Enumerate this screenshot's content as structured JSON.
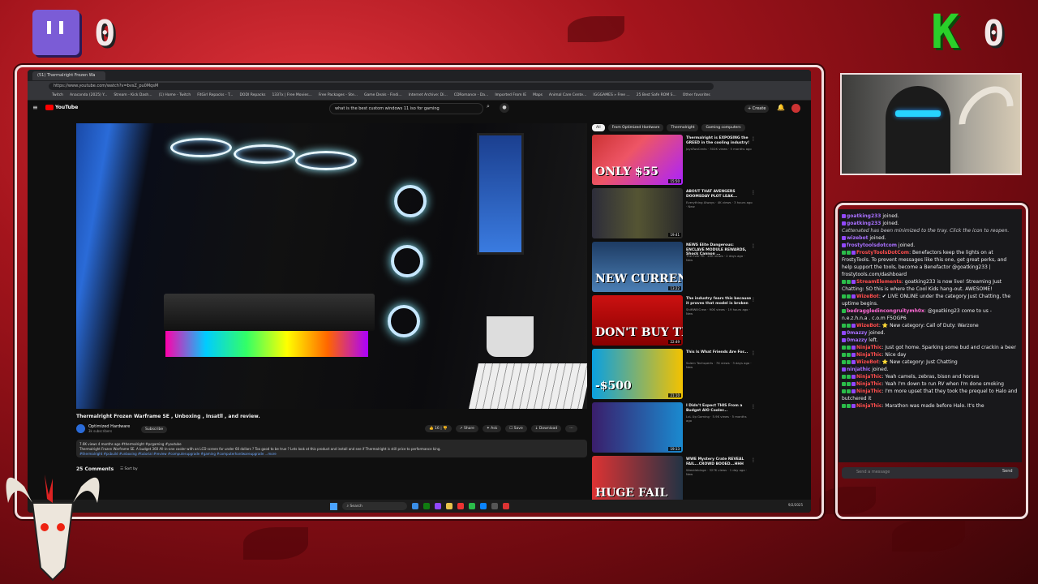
{
  "overlay": {
    "twitch_score": "0",
    "kick_score": "0",
    "colors": {
      "accent_red": "#c0141c",
      "twitch": "#7b5cd6",
      "kick": "#2ad02a"
    }
  },
  "browser": {
    "tab_title": "(51) Thermalright Frozen Wa",
    "url": "https://www.youtube.com/watch?v=bvsZ_pu0MqsM",
    "bookmarks": [
      "Twitch",
      "Anaconda (2025) Y...",
      "Stream - Kick Dash...",
      "(1) Home - Twitch",
      "FitGirl Repacks - T...",
      "DODI Repacks",
      "1337x | Free Movies...",
      "Free Packages - Ste...",
      "Game Deals - Findi...",
      "Internet Archive: Di...",
      "CDRomance - Da...",
      "Imported From IE",
      "Maps",
      "Animal Care Cente...",
      "IGGGAMES » Free ...",
      "25 Best Safe ROM S...",
      "Other favorites"
    ]
  },
  "youtube": {
    "logo_text": "YouTube",
    "search_query": "what is the best custom windows 11 iso for gaming",
    "create_label": "+ Create",
    "video_title": "Thermalright Frozen Warframe SE , Unboxing , Insatll , and review.",
    "channel_name": "Optimized Hardware",
    "channel_subs": "3k subscribers",
    "subscribe_label": "Subscribe",
    "likes": "16",
    "share_label": "Share",
    "ask_label": "Ask",
    "save_label": "Save",
    "download_label": "Download",
    "desc_line1": "7.6K views  4 months ago  #thermalright #pcgaming #youtube",
    "desc_line2": "Thermalright Frozen Warframe SE. A budget 360 All-in-one cooler with an LCD screen for under 60 dollars ? Too good to be true ? Lets look at this product and install and see if Thermalright is still price to performance king.",
    "desc_line3": "#thermalright #pcbuild #unboxing #tutorial #review #computerupgrade #gaming #computerhardwareupgrade ...more",
    "comments_label": "25 Comments",
    "sort_label": "Sort by",
    "chips": [
      "All",
      "From Optimized Hardware",
      "Thermalright",
      "Gaming computers"
    ],
    "recommended": [
      {
        "thumb_text": "ONLY $55",
        "duration": "15:50",
        "title": "Thermalright is EXPOSING the GREED in the cooling industry!",
        "meta": "JaysTwoCents · 302K views · 5 months ago"
      },
      {
        "thumb_text": "",
        "duration": "19:41",
        "title": "ABOUT THAT AVENGERS DOOMSDAY PLOT LEAK...",
        "meta": "Everything Always · 4K views · 3 hours ago · New"
      },
      {
        "thumb_text": "NEW CURRENCY EXPOSED",
        "duration": "13:22",
        "title": "NEWS Elite Dangerous: ENCLAVE MODULE REWARDS, Shock Cannon ...",
        "meta": "The Ever PK · 22K views · 2 days ago · New"
      },
      {
        "thumb_text": "DON'T BUY THIS",
        "duration": "22:49",
        "title": "The industry fears this because it proves that model is broken",
        "meta": "ShiftWillCrew · 90K views · 19 hours ago · New"
      },
      {
        "thumb_text": "-$500",
        "duration": "21:10",
        "title": "This Is What Friends Are For...",
        "meta": "Salem Techsperts · 7K views · 3 days ago · New"
      },
      {
        "thumb_text": "",
        "duration": "19:13",
        "title": "I Didn't Expect THIS From a Budget AIO Cooler...",
        "meta": "LvL Up Gaming · 5.9K views · 5 months ago"
      },
      {
        "thumb_text": "HUGE FAIL",
        "duration": "",
        "title": "WWE Mystery Crate REVEAL FAIL...CROWD BOOED...HHH",
        "meta": "Wrestlebinge · 327K views · 1 day ago · New"
      }
    ]
  },
  "taskbar": {
    "search_placeholder": "Search",
    "tray_text": "9/2/2025"
  },
  "chat": {
    "messages": [
      {
        "user": "goatking233",
        "text": " joined.",
        "color": "#a970ff",
        "badges": [
          "p"
        ]
      },
      {
        "user": "goatking233",
        "text": " joined.",
        "color": "#a970ff",
        "badges": [
          "p"
        ]
      },
      {
        "user": "",
        "text": "Cattenated has been minimized to the tray. Click the icon to reopen.",
        "color": "",
        "badges": [],
        "system": true
      },
      {
        "user": "wizebot",
        "text": " joined.",
        "color": "#a970ff",
        "badges": [
          "p"
        ]
      },
      {
        "user": "frostytoolsdotcom",
        "text": " joined.",
        "color": "#a970ff",
        "badges": [
          "p"
        ]
      },
      {
        "user": "FrostyToolsDotCom",
        "text": ": Benefactors keep the lights on at FrostyTools. To prevent messages like this one, get great perks, and help support the tools, become a Benefactor @goatking233 | frostytools.com/dashboard",
        "color": "#ff4d4d",
        "badges": [
          "g",
          "g",
          "p"
        ]
      },
      {
        "user": "StreamElements",
        "text": ": goatking233 is now live! Streaming Just Chatting: SO this is where the Cool Kids hang-out. AWESOME!",
        "color": "#ff4d4d",
        "badges": [
          "g",
          "g",
          "p"
        ]
      },
      {
        "user": "WizeBot",
        "text": ": ✔ LIVE ONLINE under the category Just Chatting, the uptime begins.",
        "color": "#ff4d4d",
        "badges": [
          "g",
          "g",
          "p"
        ]
      },
      {
        "user": "bedraggledincongruitymh0x",
        "text": ": @goatking23 come to us - n.e.z.h.n.a . c.o.m F5OGP6",
        "color": "#ff6ad5",
        "badges": [
          "g"
        ]
      },
      {
        "user": "WizeBot",
        "text": ": ⭐ New category: Call of Duty: Warzone",
        "color": "#ff4d4d",
        "badges": [
          "g",
          "g",
          "p"
        ]
      },
      {
        "user": "0mazzy",
        "text": " joined.",
        "color": "#a970ff",
        "badges": [
          "p"
        ]
      },
      {
        "user": "0mazzy",
        "text": " left.",
        "color": "#a970ff",
        "badges": [
          "p"
        ]
      },
      {
        "user": "NinjaThic",
        "text": ": Just got home. Sparking some bud and crackin a beer",
        "color": "#ff4d4d",
        "badges": [
          "g",
          "g",
          "p"
        ]
      },
      {
        "user": "NinjaThic",
        "text": ": Nice day",
        "color": "#ff4d4d",
        "badges": [
          "g",
          "g",
          "p"
        ]
      },
      {
        "user": "WizeBot",
        "text": ": ⭐ New category: Just Chatting",
        "color": "#ff4d4d",
        "badges": [
          "g",
          "g",
          "p"
        ]
      },
      {
        "user": "ninjathic",
        "text": " joined.",
        "color": "#a970ff",
        "badges": [
          "p"
        ]
      },
      {
        "user": "NinjaThic",
        "text": ": Yeah camels, zebras, bison and horses",
        "color": "#ff4d4d",
        "badges": [
          "g",
          "g",
          "p"
        ]
      },
      {
        "user": "NinjaThic",
        "text": ": Yeah I'm down to run RV when I'm done smoking",
        "color": "#ff4d4d",
        "badges": [
          "g",
          "g",
          "p"
        ]
      },
      {
        "user": "NinjaThic",
        "text": ": I'm more upset that they took the prequel to Halo and butchered it",
        "color": "#ff4d4d",
        "badges": [
          "g",
          "g",
          "p"
        ]
      },
      {
        "user": "NinjaThic",
        "text": ": Marathon was made before Halo. It's the",
        "color": "#ff4d4d",
        "badges": [
          "g",
          "g",
          "p"
        ]
      }
    ],
    "input_placeholder": "Send a message",
    "send_label": "Send"
  }
}
